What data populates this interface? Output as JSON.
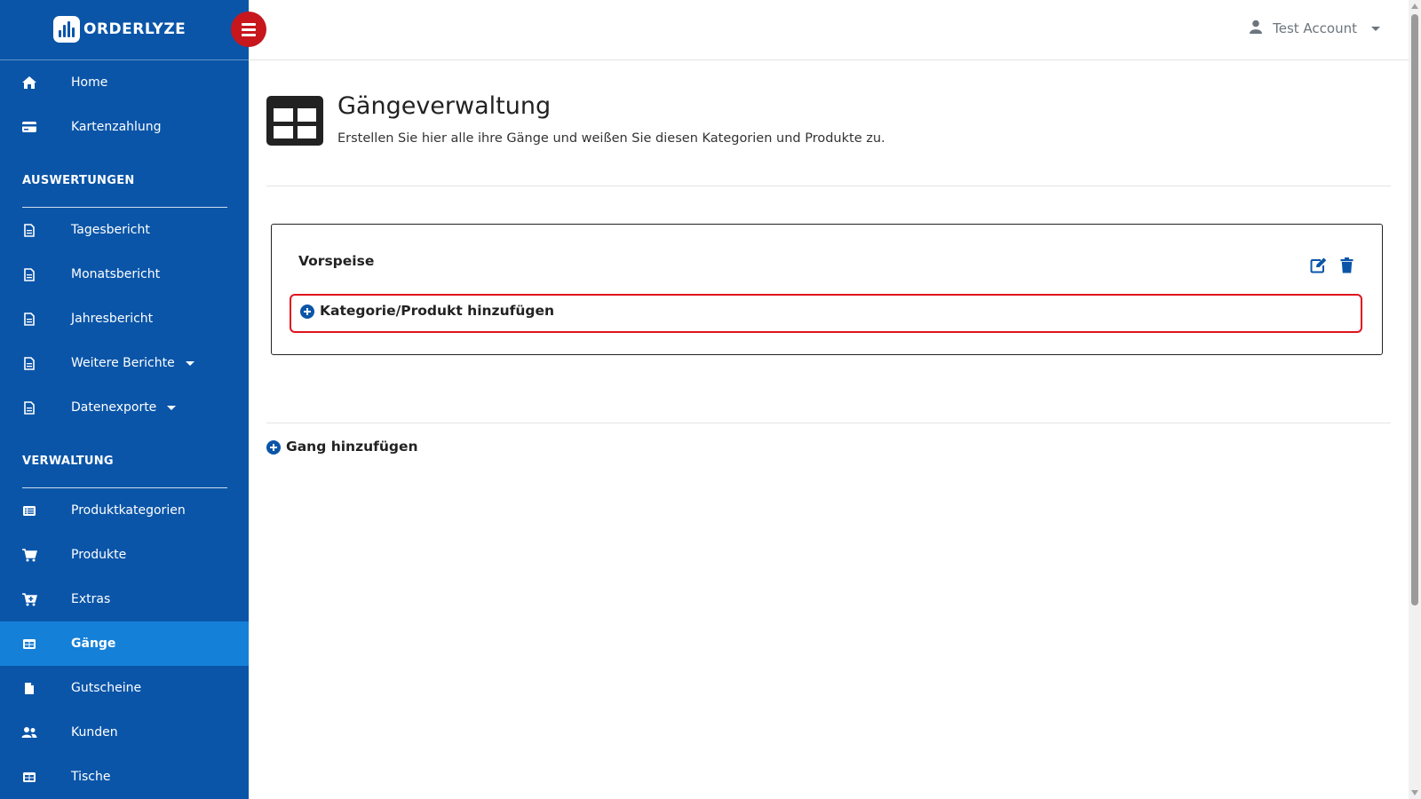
{
  "brand": {
    "name": "ORDERLYZE",
    "icon": "logo-bars-icon"
  },
  "header": {
    "account_label": "Test Account",
    "account_icon": "user-icon"
  },
  "sidebar": {
    "top_items": [
      {
        "label": "Home",
        "icon": "home-icon"
      },
      {
        "label": "Kartenzahlung",
        "icon": "credit-card-icon"
      }
    ],
    "sections": [
      {
        "title": "AUSWERTUNGEN",
        "items": [
          {
            "label": "Tagesbericht",
            "icon": "file-icon"
          },
          {
            "label": "Monatsbericht",
            "icon": "file-icon"
          },
          {
            "label": "Jahresbericht",
            "icon": "file-icon"
          },
          {
            "label": "Weitere Berichte",
            "icon": "file-icon",
            "dropdown": true
          },
          {
            "label": "Datenexporte",
            "icon": "file-icon",
            "dropdown": true
          }
        ]
      },
      {
        "title": "VERWALTUNG",
        "items": [
          {
            "label": "Produktkategorien",
            "icon": "list-icon"
          },
          {
            "label": "Produkte",
            "icon": "cart-icon"
          },
          {
            "label": "Extras",
            "icon": "cart-plus-icon"
          },
          {
            "label": "Gänge",
            "icon": "table-icon",
            "active": true
          },
          {
            "label": "Gutscheine",
            "icon": "file-filled-icon"
          },
          {
            "label": "Kunden",
            "icon": "users-icon"
          },
          {
            "label": "Tische",
            "icon": "table-icon"
          }
        ]
      }
    ]
  },
  "page": {
    "title": "Gängeverwaltung",
    "subtitle": "Erstellen Sie hier alle ihre Gänge und weißen Sie diesen Kategorien und Produkte zu.",
    "icon": "table-icon"
  },
  "course": {
    "name": "Vorspeise",
    "add_label": "Kategorie/Produkt hinzufügen",
    "highlight_color": "#e0141e"
  },
  "add_course_label": "Gang hinzufügen",
  "colors": {
    "sidebar": "#0a55a8",
    "active": "#1580d8",
    "toggle": "#c8161d"
  }
}
